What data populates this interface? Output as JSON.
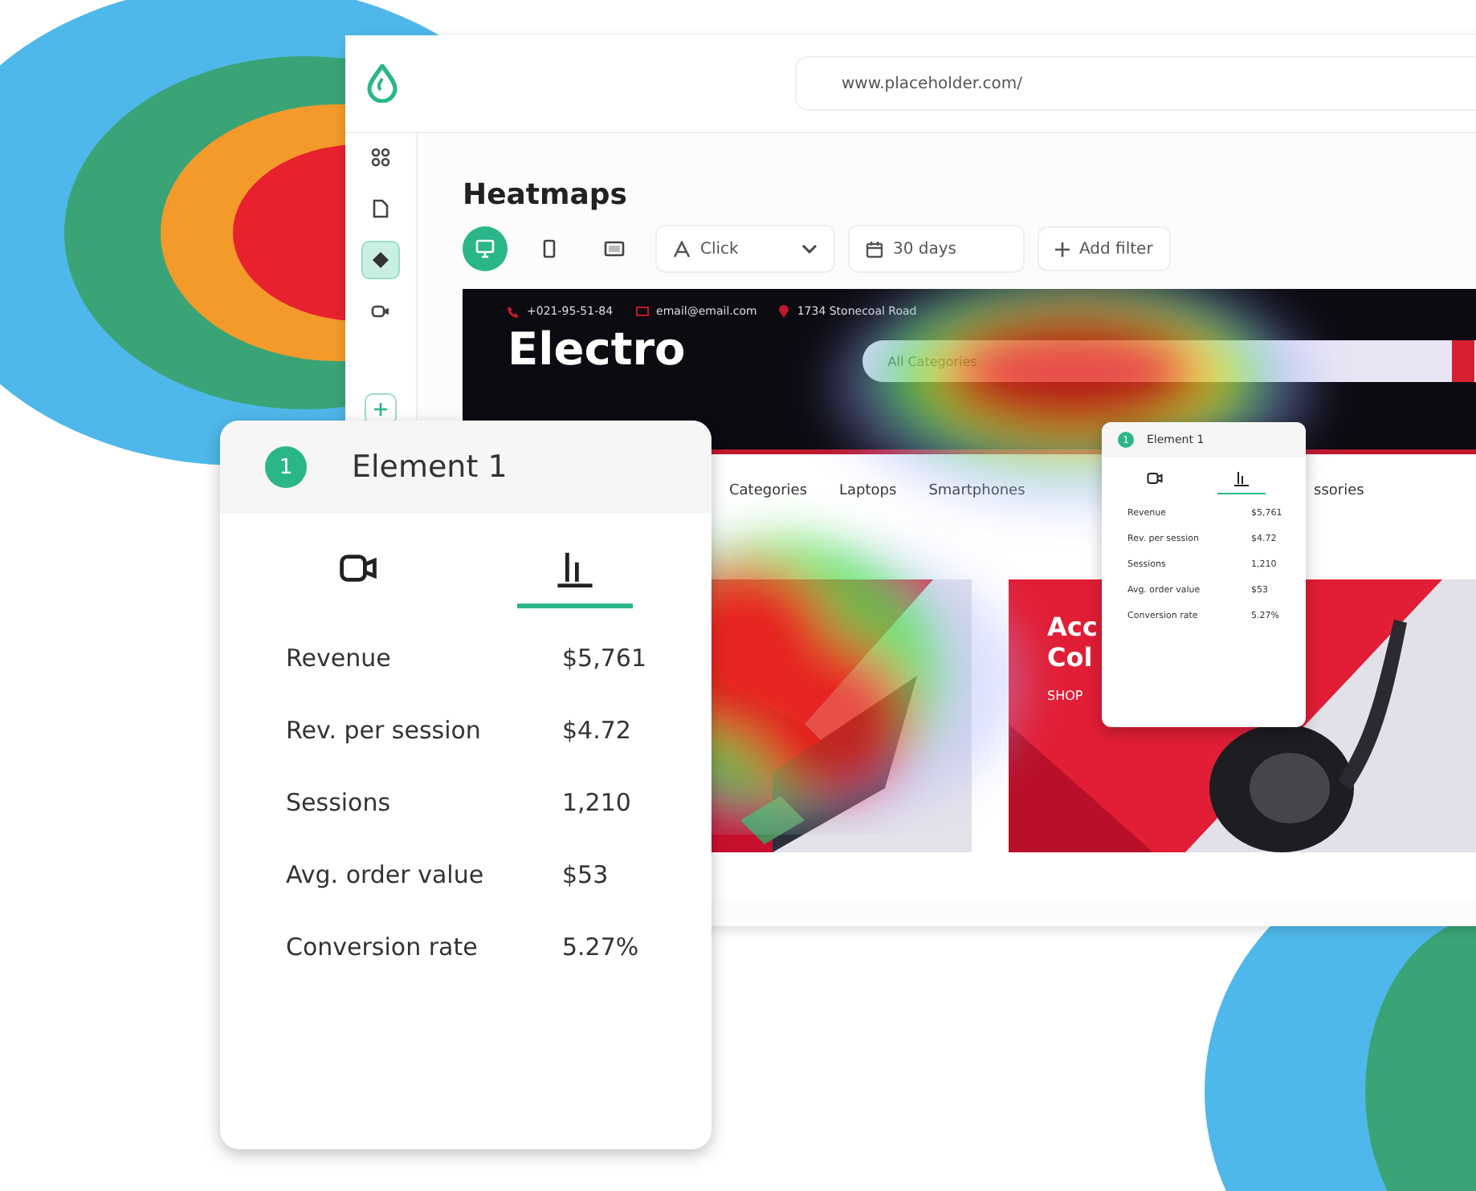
{
  "browser": {
    "url": "www.placeholder.com/"
  },
  "sidebar": {
    "items": [
      {
        "kind": "grid",
        "selected": false
      },
      {
        "kind": "document",
        "selected": false
      },
      {
        "kind": "target",
        "selected": true
      },
      {
        "kind": "camera",
        "selected": false
      },
      {
        "kind": "plus",
        "selected": false
      }
    ]
  },
  "page_title": "Heatmaps",
  "toolbar": {
    "devices": [
      {
        "kind": "desktop",
        "selected": true
      },
      {
        "kind": "mobile",
        "selected": false
      },
      {
        "kind": "tablet",
        "selected": false
      }
    ],
    "event_select": {
      "value": "Click"
    },
    "date_range": {
      "value": "30 days"
    },
    "add_filter": "Add filter"
  },
  "site": {
    "contacts": [
      {
        "kind": "phone",
        "text": "+021-95-51-84"
      },
      {
        "kind": "email",
        "text": "email@email.com"
      },
      {
        "kind": "pin",
        "text": "1734 Stonecoal Road"
      }
    ],
    "logo": "Electro",
    "search_category": "All Categories",
    "nav": [
      "Categories",
      "Laptops",
      "Smartphones",
      "ssories"
    ],
    "banners": [
      {
        "kind": "picture"
      },
      {
        "kind": "picture",
        "title_lines": [
          "Acc",
          "Col"
        ],
        "cta": "SHOP"
      }
    ]
  },
  "element_cards": [
    {
      "number": "1",
      "title": "Element 1",
      "tabs": [
        {
          "kind": "video",
          "selected": false
        },
        {
          "kind": "chart",
          "selected": true
        }
      ],
      "metrics": [
        {
          "label": "Revenue",
          "value": "$5,761"
        },
        {
          "label": "Rev. per session",
          "value": "$4.72"
        },
        {
          "label": "Sessions",
          "value": "1,210"
        },
        {
          "label": "Avg. order value",
          "value": "$53"
        },
        {
          "label": "Conversion rate",
          "value": "5.27%"
        }
      ]
    },
    {
      "number": "1",
      "title": "Element 1",
      "tabs": [
        {
          "kind": "video",
          "selected": false
        },
        {
          "kind": "chart",
          "selected": true
        }
      ],
      "metrics": [
        {
          "label": "Revenue",
          "value": "$5,761"
        },
        {
          "label": "Rev. per session",
          "value": "$4.72"
        },
        {
          "label": "Sessions",
          "value": "1,210"
        },
        {
          "label": "Avg. order value",
          "value": "$53"
        },
        {
          "label": "Conversion rate",
          "value": "5.27%"
        }
      ]
    }
  ]
}
